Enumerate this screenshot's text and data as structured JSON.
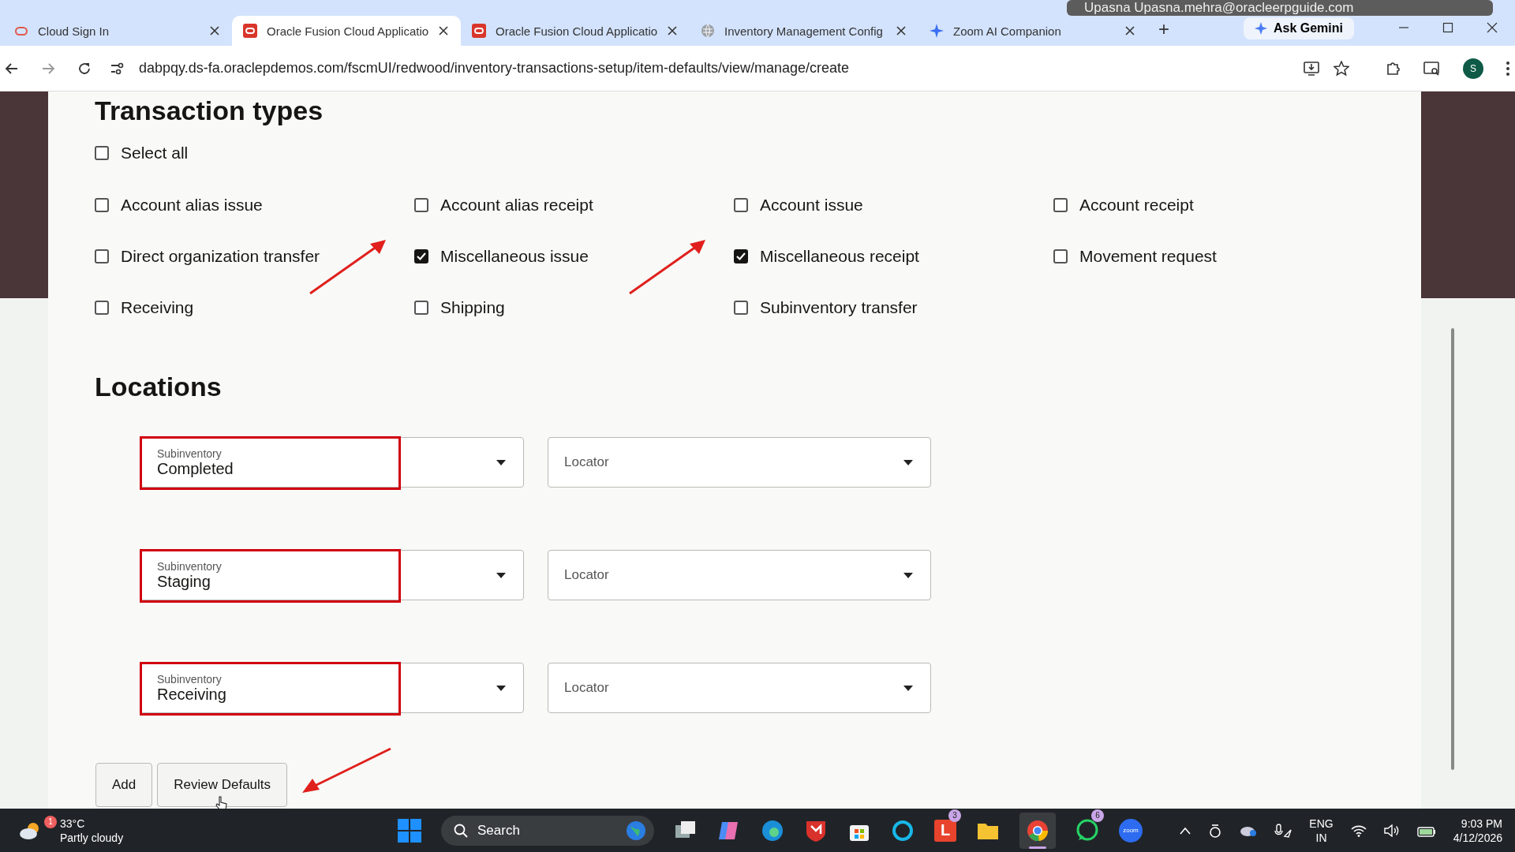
{
  "browser": {
    "tabs": [
      {
        "title": "Cloud Sign In",
        "kind": "outline",
        "selected": false
      },
      {
        "title": "Oracle Fusion Cloud Applicatio",
        "kind": "app",
        "selected": true
      },
      {
        "title": "Oracle Fusion Cloud Applicatio",
        "kind": "app",
        "selected": false
      },
      {
        "title": "Inventory Management Config",
        "kind": "web",
        "selected": false
      },
      {
        "title": "Zoom AI Companion",
        "kind": "assistant",
        "selected": false
      }
    ],
    "new_tab": "+",
    "ask_gemini": "Ask Gemini",
    "url": "dabpqy.ds-fa.oraclepdemos.com/fscmUI/redwood/inventory-transactions-setup/item-defaults/view/manage/create",
    "profile": "S",
    "overlay_label": "Upasna Upasna.mehra@oracleerpguide.com"
  },
  "transaction_types": {
    "heading": "Transaction types",
    "select_all": {
      "label": "Select all",
      "checked": false
    },
    "options": [
      {
        "label": "Account alias issue",
        "checked": false,
        "annotated": false
      },
      {
        "label": "Account alias receipt",
        "checked": false,
        "annotated": false
      },
      {
        "label": "Account issue",
        "checked": false,
        "annotated": false
      },
      {
        "label": "Account receipt",
        "checked": false,
        "annotated": false
      },
      {
        "label": "Direct organization transfer",
        "checked": false,
        "annotated": false
      },
      {
        "label": "Miscellaneous issue",
        "checked": true,
        "annotated": true
      },
      {
        "label": "Miscellaneous receipt",
        "checked": true,
        "annotated": true
      },
      {
        "label": "Movement request",
        "checked": false,
        "annotated": false
      },
      {
        "label": "Receiving",
        "checked": false,
        "annotated": false
      },
      {
        "label": "Shipping",
        "checked": false,
        "annotated": false
      },
      {
        "label": "Subinventory transfer",
        "checked": false,
        "annotated": false
      }
    ]
  },
  "locations": {
    "heading": "Locations",
    "rows": [
      {
        "subinventory": {
          "label": "Subinventory",
          "value": "Completed"
        },
        "locator": {
          "placeholder": "Locator"
        },
        "highlighted": true
      },
      {
        "subinventory": {
          "label": "Subinventory",
          "value": "Staging"
        },
        "locator": {
          "placeholder": "Locator"
        },
        "highlighted": true
      },
      {
        "subinventory": {
          "label": "Subinventory",
          "value": "Receiving"
        },
        "locator": {
          "placeholder": "Locator"
        },
        "highlighted": true
      }
    ]
  },
  "buttons": [
    {
      "label": "Add",
      "annotated": false
    },
    {
      "label": "Review Defaults",
      "annotated": true
    }
  ],
  "taskbar": {
    "weather": {
      "temperature": "33°C",
      "condition": "Partly cloudy",
      "badge": "1"
    },
    "search": "Search",
    "apps": [
      {
        "kind": "windows"
      },
      {
        "kind": "taskview"
      },
      {
        "kind": "copilot"
      },
      {
        "kind": "edge"
      },
      {
        "kind": "shield"
      },
      {
        "kind": "store"
      },
      {
        "kind": "ring"
      },
      {
        "kind": "letter",
        "letter": "L",
        "badge": "3"
      },
      {
        "kind": "folder"
      },
      {
        "kind": "chrome",
        "active": true
      },
      {
        "kind": "chat",
        "badge": "6"
      },
      {
        "kind": "zoom",
        "letter": "zoom"
      }
    ],
    "language": "ENG",
    "region": "IN",
    "time": "9:03 PM",
    "date": "4/12/2026"
  }
}
